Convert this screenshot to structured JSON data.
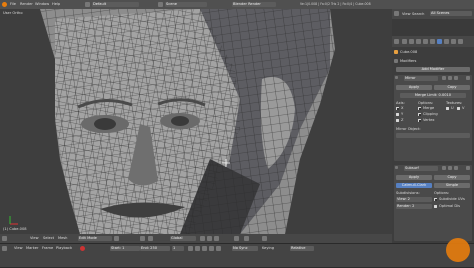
{
  "top_bar": {
    "layout_field": "Default",
    "scene_field": "Scene",
    "engine_field": "Blender Render",
    "stats": "Ve:1|0.008 | Fa:0/2 Tris 2 | Fa:0/4 | Cube.008"
  },
  "viewport": {
    "title": "User Ortho",
    "object_label": "(1) Cube.008"
  },
  "outliner": {
    "view_label": "View",
    "search_label": "Search",
    "scenes_field": "All Scenes"
  },
  "properties": {
    "object_name": "Cube.008",
    "modifiers_label": "Modifiers",
    "add_modifier": "Add Modifier",
    "mirror": {
      "name": "Mirror",
      "apply": "Apply",
      "copy": "Copy",
      "merge_limit": "Merge Limit: 0.0010",
      "axis_label": "Axis:",
      "options_label": "Options:",
      "textures_label": "Textures:",
      "x": "X",
      "y": "Y",
      "z": "Z",
      "merge": "Merge",
      "clipping": "Clipping",
      "vertex": "Vertex",
      "u": "U",
      "v": "V",
      "mirror_object": "Mirror Object:"
    },
    "subsurf": {
      "name": "Subsurf",
      "apply": "Apply",
      "copy": "Copy",
      "catmull": "Catmull-Clark",
      "simple": "Simple",
      "subdivisions": "Subdivisions:",
      "view": "View: 2",
      "render": "Render: 2",
      "options_label": "Options:",
      "subdivide_uvs": "Subdivide UVs",
      "optimal_display": "Optimal Dis"
    }
  },
  "viewport_header": {
    "view": "View",
    "select": "Select",
    "mesh": "Mesh",
    "mode": "Edit Mode",
    "pivot": "Global"
  },
  "timeline": {
    "view": "View",
    "marker": "Marker",
    "frame": "Frame",
    "playback": "Playback",
    "start": "Start: 1",
    "end": "End: 250",
    "current": "1",
    "no_sync": "No Sync",
    "keying": "Keying",
    "relative": "Relative"
  },
  "colors": {
    "accent": "#5680c2",
    "panel": "#474747",
    "viewport": "#3d3d3d"
  }
}
